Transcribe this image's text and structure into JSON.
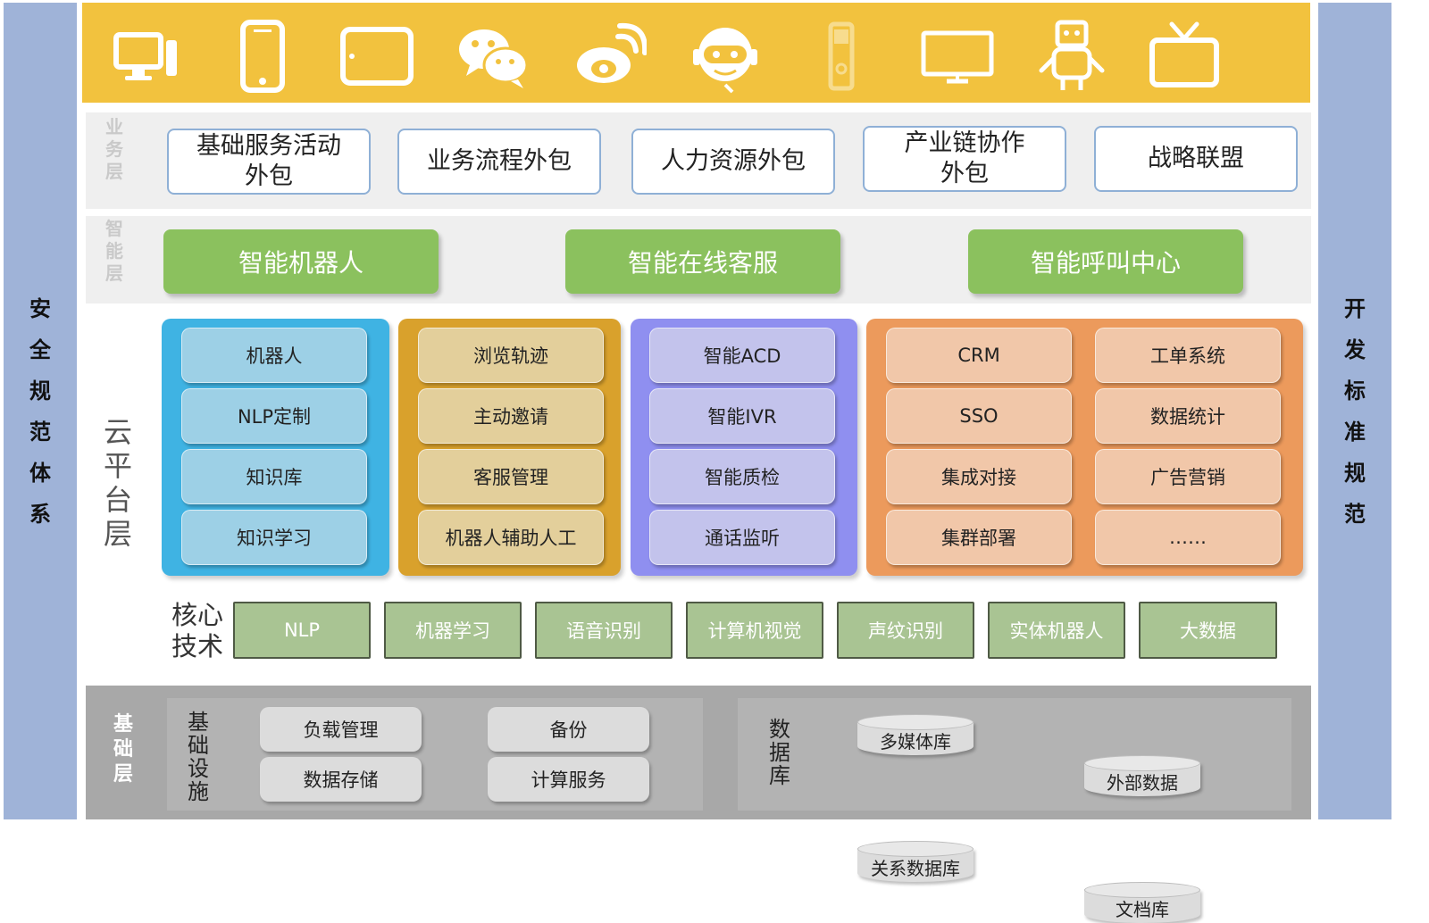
{
  "left_bar": {
    "label": [
      "安",
      "全",
      "规",
      "范",
      "体",
      "系"
    ]
  },
  "right_bar": {
    "label": [
      "开",
      "发",
      "标",
      "准",
      "规",
      "范"
    ]
  },
  "top_band": {
    "icons": [
      "desktop-computer-icon",
      "mobile-phone-icon",
      "tablet-icon",
      "wechat-icon",
      "weibo-icon",
      "customer-service-robot-icon",
      "feature-phone-icon",
      "tv-monitor-icon",
      "robot-icon",
      "television-icon"
    ]
  },
  "business_layer": {
    "label": [
      "业",
      "务",
      "层"
    ],
    "items": [
      "基础服务活动\n外包",
      "业务流程外包",
      "人力资源外包",
      "产业链协作\n外包",
      "战略联盟"
    ]
  },
  "smart_layer": {
    "label": [
      "智",
      "能",
      "层"
    ],
    "items": [
      "智能机器人",
      "智能在线客服",
      "智能呼叫中心"
    ]
  },
  "cloud_layer": {
    "label": [
      "云",
      "平",
      "台",
      "层"
    ],
    "panels": [
      {
        "color": "#3fb3e3",
        "pill_color": "#9dd0e6",
        "items": [
          "机器人",
          "NLP定制",
          "知识库",
          "知识学习"
        ]
      },
      {
        "color": "#d9a12c",
        "pill_color": "#e3cf9b",
        "items": [
          "浏览轨迹",
          "主动邀请",
          "客服管理",
          "机器人辅助人工"
        ]
      },
      {
        "color": "#8f8ff0",
        "pill_color": "#c3c3ec",
        "items": [
          "智能ACD",
          "智能IVR",
          "智能质检",
          "通话监听"
        ]
      },
      {
        "color": "#ec9a5c",
        "pill_color": "#f1c7a9",
        "items": [
          "CRM",
          "工单系统",
          "SSO",
          "数据统计",
          "集成对接",
          "广告营销",
          "集群部署",
          "……"
        ]
      }
    ]
  },
  "core_tech": {
    "label": [
      "核心",
      "技术"
    ],
    "items": [
      "NLP",
      "机器学习",
      "语音识别",
      "计算机视觉",
      "声纹识别",
      "实体机器人",
      "大数据"
    ]
  },
  "base_layer": {
    "label": [
      "基",
      "础",
      "层"
    ],
    "infra_label": [
      "基",
      "础",
      "设",
      "施"
    ],
    "infra_items": [
      "负载管理",
      "备份",
      "数据存储",
      "计算服务"
    ],
    "db_label": [
      "数",
      "据",
      "库"
    ],
    "db_items": [
      "多媒体库",
      "外部数据",
      "关系数据库",
      "文档库"
    ]
  }
}
